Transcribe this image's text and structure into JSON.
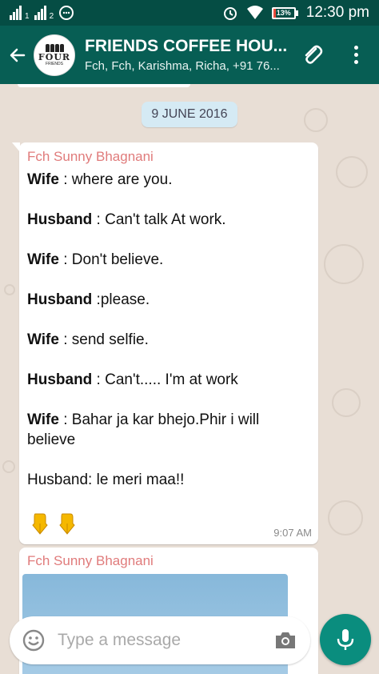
{
  "status_bar": {
    "sim1": "1",
    "sim2": "2",
    "battery_text": "13%",
    "battery_level": 0.13,
    "time": "12:30 pm"
  },
  "app_bar": {
    "title": "FRIENDS COFFEE HOU...",
    "subtitle": "Fch, Fch, Karishma, Richa, +91 76...",
    "avatar_text": "FOUR",
    "avatar_sub": "FRIENDS"
  },
  "chat": {
    "date_chip": "9 JUNE 2016",
    "message1": {
      "sender": "Fch Sunny Bhagnani",
      "lines": [
        {
          "speaker": "Wife",
          "text": "  : where are you."
        },
        {
          "speaker": "",
          "text": ""
        },
        {
          "speaker": "Husband",
          "text": " : Can't talk At work."
        },
        {
          "speaker": "",
          "text": ""
        },
        {
          "speaker": "Wife",
          "text": " : Don't believe."
        },
        {
          "speaker": "",
          "text": ""
        },
        {
          "speaker": "Husband",
          "text": " :please."
        },
        {
          "speaker": "",
          "text": ""
        },
        {
          "speaker": "Wife",
          "text": " : send selfie."
        },
        {
          "speaker": "",
          "text": ""
        },
        {
          "speaker": "Husband",
          "text": " : Can't..... I'm at work"
        },
        {
          "speaker": "",
          "text": ""
        },
        {
          "speaker": "Wife",
          "text": " : Bahar ja kar bhejo.Phir i will believe"
        },
        {
          "speaker": "",
          "text": ""
        },
        {
          "speaker": "",
          "text": "Husband: le meri maa!!"
        }
      ],
      "emojis": "👇👇",
      "time": "9:07 AM"
    },
    "message2": {
      "sender": "Fch Sunny Bhagnani"
    }
  },
  "input": {
    "placeholder": "Type a message"
  },
  "colors": {
    "header": "#075e54",
    "status_bar": "#054d44",
    "sender": "#e07b7b",
    "mic_button": "#0a8d7e",
    "date_chip": "#d5eaf4"
  },
  "icons": [
    "back-arrow-icon",
    "paperclip-icon",
    "more-vert-icon",
    "smiley-icon",
    "camera-icon",
    "mic-icon",
    "signal-icon",
    "alarm-icon",
    "wifi-icon",
    "battery-icon",
    "whatsapp-icon"
  ]
}
